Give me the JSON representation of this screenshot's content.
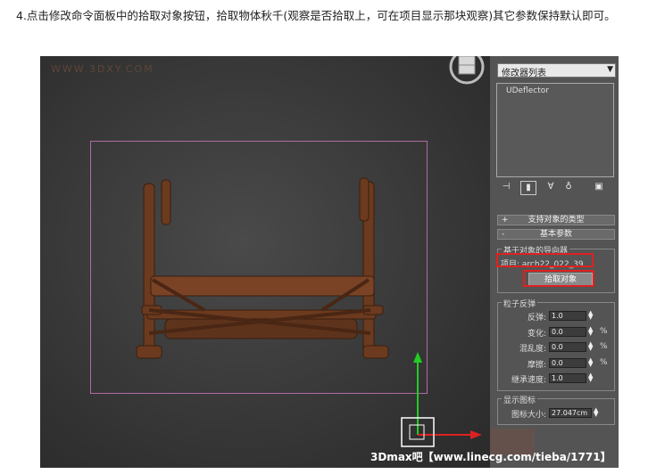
{
  "instruction": {
    "text": "4.点击修改命令面板中的拾取对象按钮，拾取物体秋千(观察是否拾取上，可在项目显示那块观察)其它参数保持默认即可。"
  },
  "viewport": {
    "watermark": "WWW.3DXY.COM"
  },
  "panel": {
    "modifier_list": "修改器列表",
    "stack_items": [
      "UDeflector"
    ],
    "rollouts": [
      {
        "sign": "+",
        "title": "支持对象的类型"
      },
      {
        "sign": "-",
        "title": "基本参数"
      }
    ],
    "deflector_group": {
      "title": "基于对象的导向器",
      "item_text": "项目: arch22_022_39",
      "pick_button": "拾取对象"
    },
    "particle_group": {
      "title": "粒子反弹",
      "fields": [
        {
          "label": "反弹:",
          "value": "1.0",
          "unit": ""
        },
        {
          "label": "变化:",
          "value": "0.0",
          "unit": "%"
        },
        {
          "label": "混乱度:",
          "value": "0.0",
          "unit": "%"
        },
        {
          "label": "摩擦:",
          "value": "0.0",
          "unit": "%"
        },
        {
          "label": "继承速度:",
          "value": "1.0",
          "unit": ""
        }
      ]
    },
    "display_group": {
      "title": "显示图标",
      "icon_size_label": "图标大小:",
      "icon_size_value": "27.047cm"
    }
  },
  "footer": {
    "credit": "3Dmax吧【www.linecg.com/tieba/1771】"
  },
  "colors": {
    "highlight": "#e02020",
    "selection": "#b06aa8",
    "gizmo_y": "#22cc22",
    "gizmo_x": "#dd2222"
  }
}
